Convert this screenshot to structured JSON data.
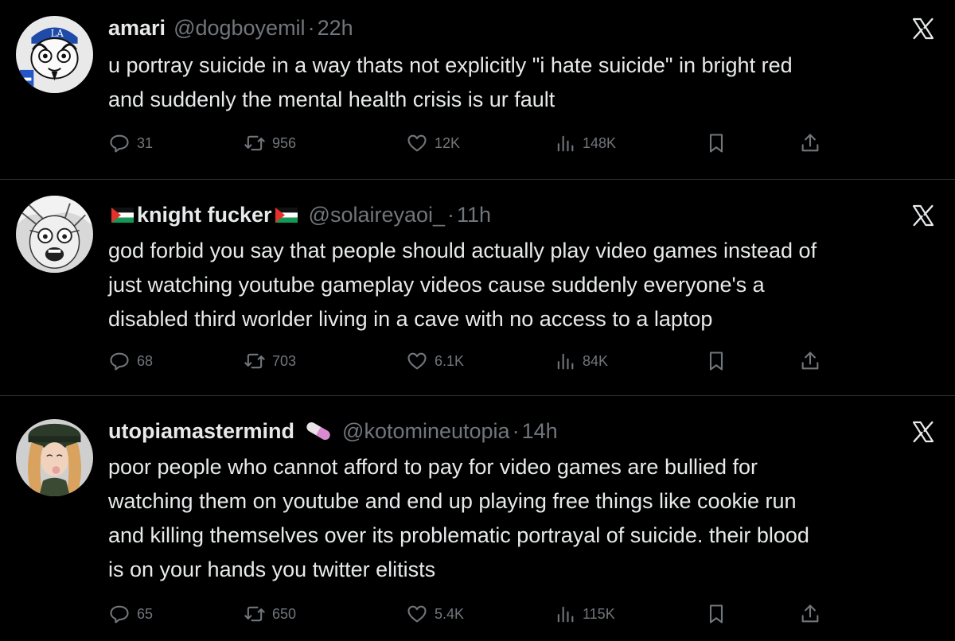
{
  "tweets": [
    {
      "name": "amari",
      "handle": "@dogboyemil",
      "separator": "·",
      "time": "22h",
      "lines": [
        "u portray suicide in a way thats not explicitly \"i hate suicide\" in bright red",
        "and suddenly the mental health crisis is ur fault"
      ],
      "replies": "31",
      "reposts": "956",
      "likes": "12K",
      "views": "148K"
    },
    {
      "name": "knight fucker",
      "handle": "@solaireyaoi_",
      "separator": "·",
      "time": "11h",
      "lines": [
        "god forbid you say that people should actually play video games instead of",
        "just watching youtube gameplay videos cause suddenly everyone's a",
        "disabled third worlder living in a cave with no access to a laptop"
      ],
      "replies": "68",
      "reposts": "703",
      "likes": "6.1K",
      "views": "84K"
    },
    {
      "name": "utopiamastermind",
      "handle": "@kotomineutopia",
      "separator": "·",
      "time": "14h",
      "lines": [
        "poor people who cannot afford to pay for video games are bullied for",
        "watching them on youtube and end up playing free things like cookie run",
        "and killing themselves over its problematic portrayal of suicide. their blood",
        "is on your hands you twitter elitists"
      ],
      "replies": "65",
      "reposts": "650",
      "likes": "5.4K",
      "views": "115K"
    }
  ],
  "icons": {
    "reply": "reply-icon",
    "repost": "repost-icon",
    "like": "like-icon",
    "views": "views-icon",
    "bookmark": "bookmark-icon",
    "share": "share-icon",
    "x": "x-logo-icon"
  },
  "colors": {
    "background": "#000000",
    "text": "#e7e9ea",
    "muted": "#71767b",
    "divider": "#2f3336"
  }
}
